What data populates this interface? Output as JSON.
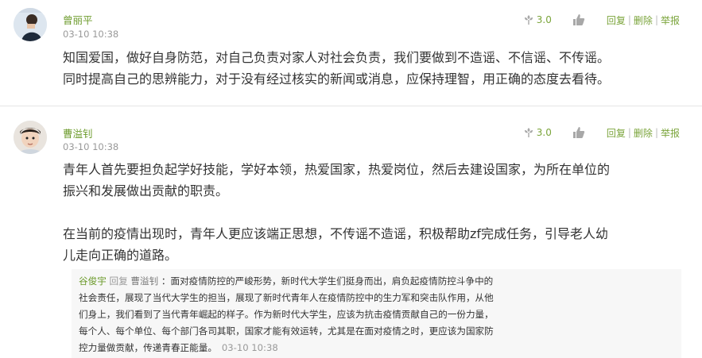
{
  "comments": [
    {
      "author": "曾丽平",
      "time": "03-10 10:38",
      "score": "3.0",
      "actions": [
        "回复",
        "删除",
        "举报"
      ],
      "separator": "|",
      "lines": [
        "知国爱国，做好自身防范，对自己负责对家人对社会负责，我们要做到不造谣、不信谣、不传谣。",
        "同时提高自己的思辨能力，对于没有经过核实的新闻或消息，应保持理智，用正确的态度去看待。"
      ]
    },
    {
      "author": "曹溢钊",
      "time": "03-10 10:38",
      "score": "3.0",
      "actions": [
        "回复",
        "删除",
        "举报"
      ],
      "separator": "|",
      "lines": [
        "青年人首先要担负起学好技能，学好本领，热爱国家，热爱岗位，然后去建设国家，为所在单位的",
        "振兴和发展做出贡献的职责。",
        "在当前的疫情出现时，青年人更应该端正思想，不传谣不造谣，积极帮助zf完成任务，引导老人幼",
        "儿走向正确的道路。"
      ],
      "reply": {
        "author": "谷俊宇",
        "reply_word": "回复",
        "target": "曹溢钊",
        "colon": "：",
        "lines": [
          "面对疫情防控的严峻形势，新时代大学生们挺身而出，肩负起疫情防控斗争中的",
          "社会责任，展现了当代大学生的担当，展现了新时代青年人在疫情防控中的生力军和突击队作用，从他",
          "们身上，我们看到了当代青年崛起的样子。作为新时代大学生，应该为抗击疫情贡献自己的一份力量，",
          "每个人、每个单位、每个部门各司其职，国家才能有效运转，尤其是在面对疫情之时，更应该为国家防",
          "控力量做贡献，传递青春正能量。"
        ],
        "time": "03-10 10:38"
      }
    }
  ],
  "colors": {
    "author": "#6b9a2a",
    "action": "#7aa43a",
    "meta": "#999999",
    "text": "#333333",
    "divider": "#e5e5e5"
  }
}
